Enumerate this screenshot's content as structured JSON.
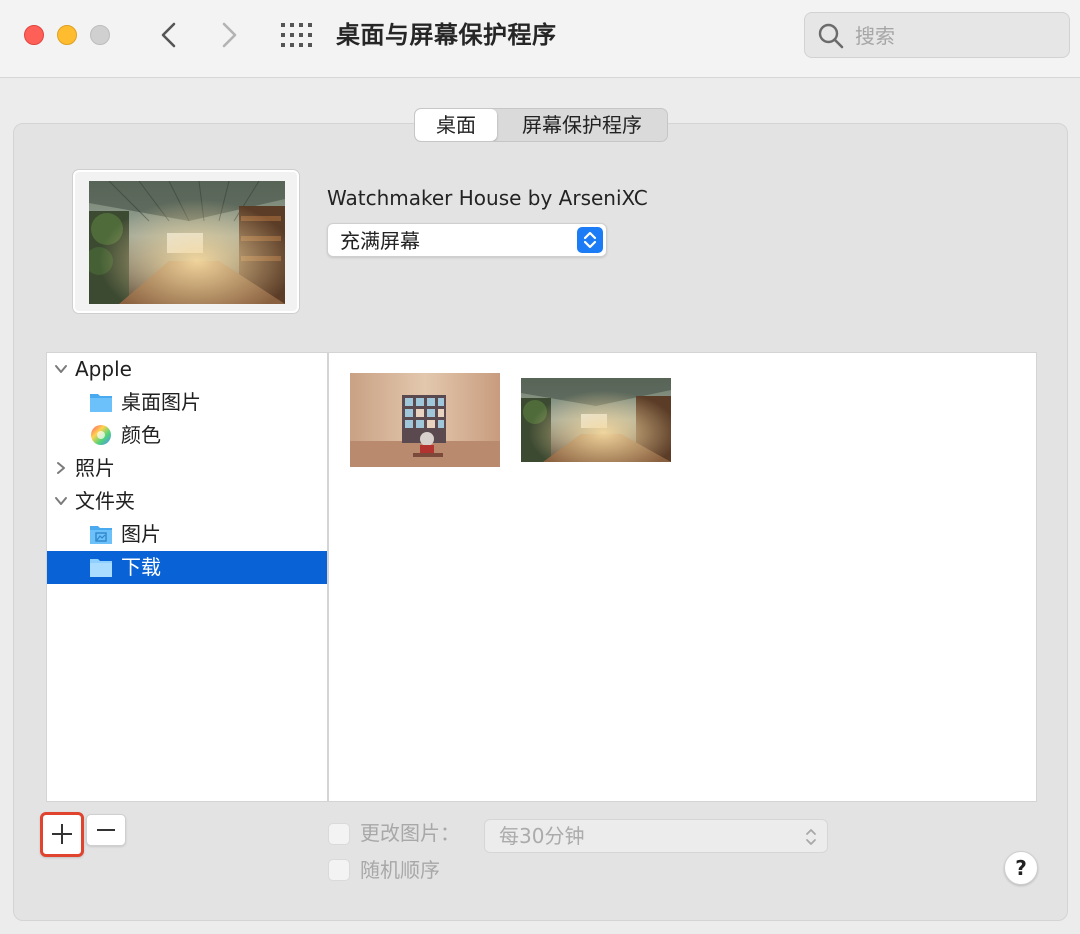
{
  "window": {
    "title": "桌面与屏幕保护程序",
    "search_placeholder": "搜索"
  },
  "tabs": [
    {
      "label": "桌面",
      "selected": true
    },
    {
      "label": "屏幕保护程序",
      "selected": false
    }
  ],
  "current_wallpaper": {
    "name": "Watchmaker House by ArseniXC",
    "fit_option": "充满屏幕"
  },
  "sources": [
    {
      "label": "Apple",
      "type": "group",
      "expanded": true
    },
    {
      "label": "桌面图片",
      "type": "folder-icon"
    },
    {
      "label": "颜色",
      "type": "color-wheel-icon"
    },
    {
      "label": "照片",
      "type": "group",
      "expanded": false
    },
    {
      "label": "文件夹",
      "type": "group",
      "expanded": true
    },
    {
      "label": "图片",
      "type": "pictures-folder-icon"
    },
    {
      "label": "下载",
      "type": "downloads-folder-icon",
      "selected": true
    }
  ],
  "images": [
    {
      "name": "bookshelf-room-wallpaper"
    },
    {
      "name": "watchmaker-house-wallpaper",
      "selected": true
    }
  ],
  "controls": {
    "add_label": "+",
    "remove_label": "−",
    "change_picture_label": "更改图片：",
    "interval": "每30分钟",
    "random_order_label": "随机顺序",
    "help_label": "?"
  },
  "colors": {
    "accent": "#0a63d6",
    "highlight_border": "#e0442e",
    "close": "#fe5f57",
    "minimize": "#febc2e"
  }
}
